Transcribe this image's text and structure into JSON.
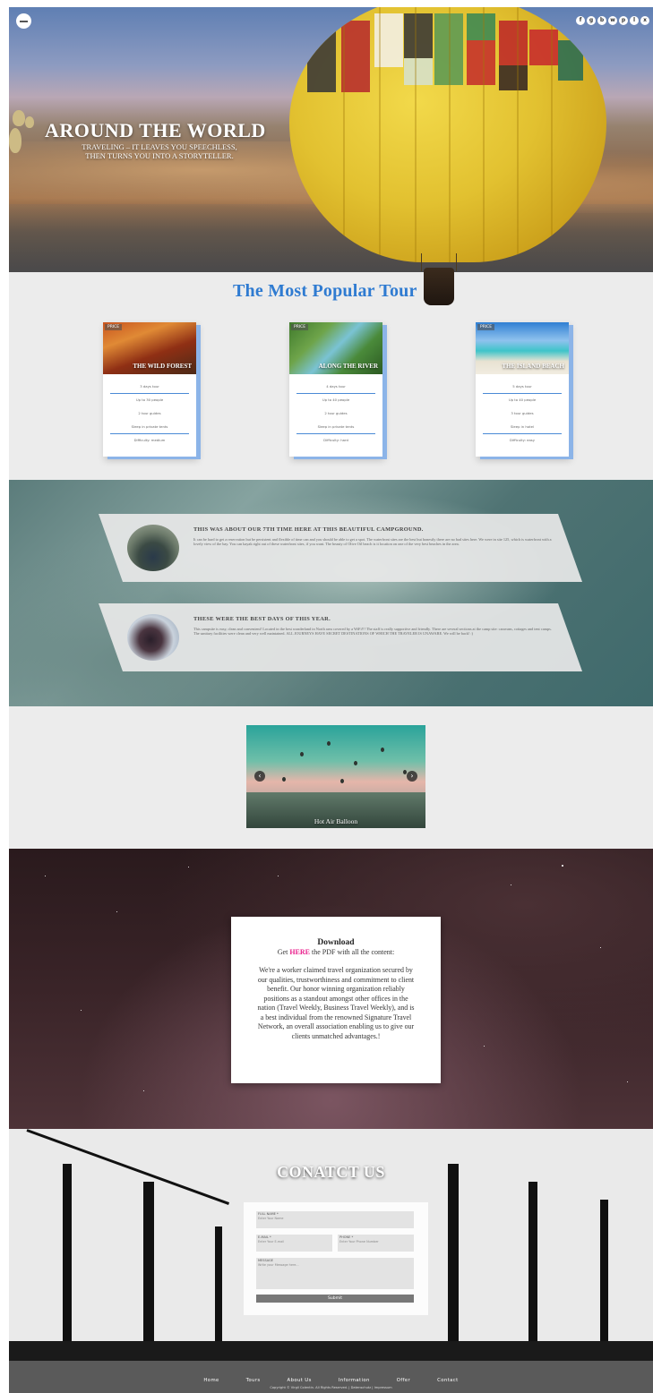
{
  "hero": {
    "title": "AROUND THE WORLD",
    "subtitle_line1": "TRAVELING – IT LEAVES YOU SPEECHLESS,",
    "subtitle_line2": "THEN TURNS YOU INTO A STORYTELLER.",
    "social_icons": [
      "f",
      "g",
      "b",
      "w",
      "p",
      "l",
      "x"
    ]
  },
  "tours": {
    "heading": "The Most Popular Tour",
    "cards": [
      {
        "price_label": "PRICE",
        "name": "THE WILD FOREST",
        "features": [
          "3 days tour",
          "Up to 30 people",
          "2 tour guides",
          "Sleep in private tents",
          "Difficulty: medium"
        ]
      },
      {
        "price_label": "PRICE",
        "name": "ALONG THE RIVER",
        "features": [
          "4 days tour",
          "Up to 40 people",
          "2 tour guides",
          "Sleep in private tents",
          "Difficulty: hard"
        ]
      },
      {
        "price_label": "PRICE",
        "name": "THE ISLAND BEACH",
        "features": [
          "5 days tour",
          "Up to 40 people",
          "3 tour guides",
          "Sleep in hotel",
          "Difficulty: easy"
        ]
      }
    ]
  },
  "testimonials": [
    {
      "title": "THIS WAS ABOUT OUR 7TH TIME HERE AT THIS BEAUTIFUL CAMPGROUND.",
      "text": "It can be hard to get a reservation but be persistent and flexible of time can and you should be able to get a spot. The waterfront sites are the best but honestly there are no bad sites here. We were in site 125, which is waterfront with a lovely view of the bay. You can kayak right out of these waterfront sites, if you want. The beauty of Olive Oil beach is it location on one of the very best beaches in the area."
    },
    {
      "title": "THESE WERE THE BEST DAYS OF THIS YEAR.",
      "text": "This campsite is easy, clean and convenient! Located in the best wonderland in North area covered by a WiFi!!! The staff is really supportive and friendly. There are several sections at the camp site: caravans, cottages and tent camps. The sanitary facilities were clean and very well maintained. ALL JOURNEYS HAVE SECRET DESTINATIONS OF WHICH THE TRAVELER IS UNAWARE. We will be back! :)"
    }
  ],
  "slider": {
    "caption": "Hot Air Balloon",
    "prev": "‹",
    "next": "›"
  },
  "download": {
    "title": "Download",
    "line_prefix": "Get ",
    "link_text": "HERE",
    "line_suffix": " the PDF with all the content:",
    "body": "We're a worker claimed travel organization secured by our qualities, trustworthiness and commitment to client benefit. Our honor winning organization reliably positions as a standout amongst other offices in the nation (Travel Weekly, Business Travel Weekly), and is a best individual from the renowned Signature Travel Network, an overall association enabling us to give our clients unmatched advantages.!"
  },
  "contact": {
    "title": "CONATCT US",
    "full_name_label": "FULL NAME *",
    "full_name_placeholder": "Enter Your Name",
    "email_label": "E-MAIL *",
    "email_placeholder": "Enter Your E-mail",
    "phone_label": "PHONE *",
    "phone_placeholder": "Enter Your Phone Number",
    "message_label": "MESSAGE",
    "message_placeholder": "Write your Message here...",
    "submit_label": "Submit"
  },
  "footer": {
    "nav": [
      "Home",
      "Tours",
      "About Us",
      "Information",
      "Offer",
      "Contact"
    ],
    "copyright": "Copyright © Virgil Colentin. All Rights Reserved. | Datenschutz | Impressum"
  },
  "colors": {
    "accent_blue": "#2f7bd1",
    "link_pink": "#e91e8c",
    "footer_gray": "#5a5a5a"
  }
}
